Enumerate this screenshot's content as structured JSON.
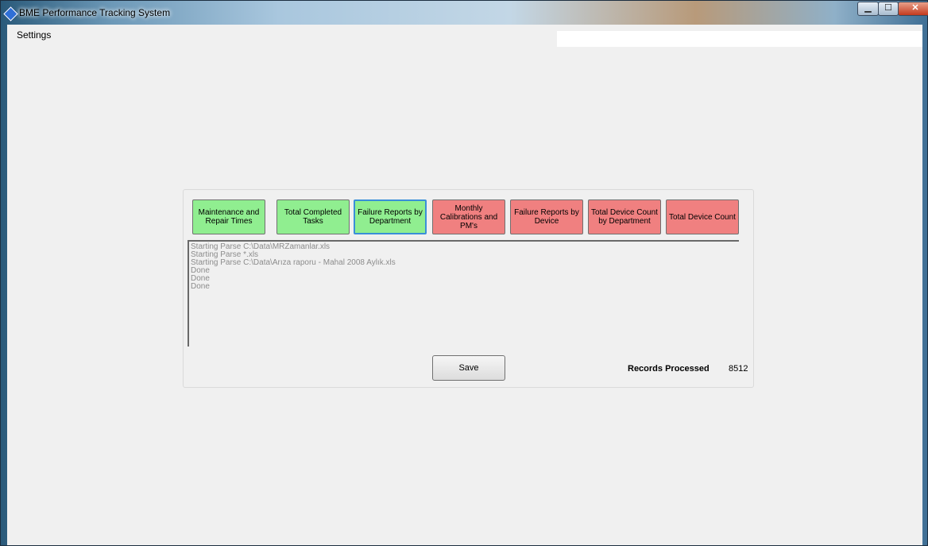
{
  "window": {
    "title": "BME Performance Tracking System",
    "controls": {
      "minimize": "▁",
      "maximize": "☐",
      "close": "✕"
    }
  },
  "menu": {
    "settings_label": "Settings"
  },
  "report_buttons": [
    {
      "label": "Maintenance and Repair Times",
      "color": "#90ee90"
    },
    {
      "label": "Total Completed Tasks",
      "color": "#90ee90"
    },
    {
      "label": "Failure Reports by Department",
      "color": "#90ee90"
    },
    {
      "label": "Monthly Calibrations and PM's",
      "color": "#f08080"
    },
    {
      "label": "Failure Reports by Device",
      "color": "#f08080"
    },
    {
      "label": "Total Device Count by Department",
      "color": "#f08080"
    },
    {
      "label": "Total Device Count",
      "color": "#f08080"
    }
  ],
  "log": {
    "lines": [
      "Starting Parse C:\\Data\\MRZamanlar.xls",
      "Starting Parse *.xls",
      "Starting Parse C:\\Data\\Arıza raporu - Mahal 2008 Aylık.xls",
      "Done",
      "Done",
      "Done"
    ]
  },
  "footer": {
    "save_label": "Save",
    "records_label": "Records Processed",
    "records_value": "8512"
  }
}
